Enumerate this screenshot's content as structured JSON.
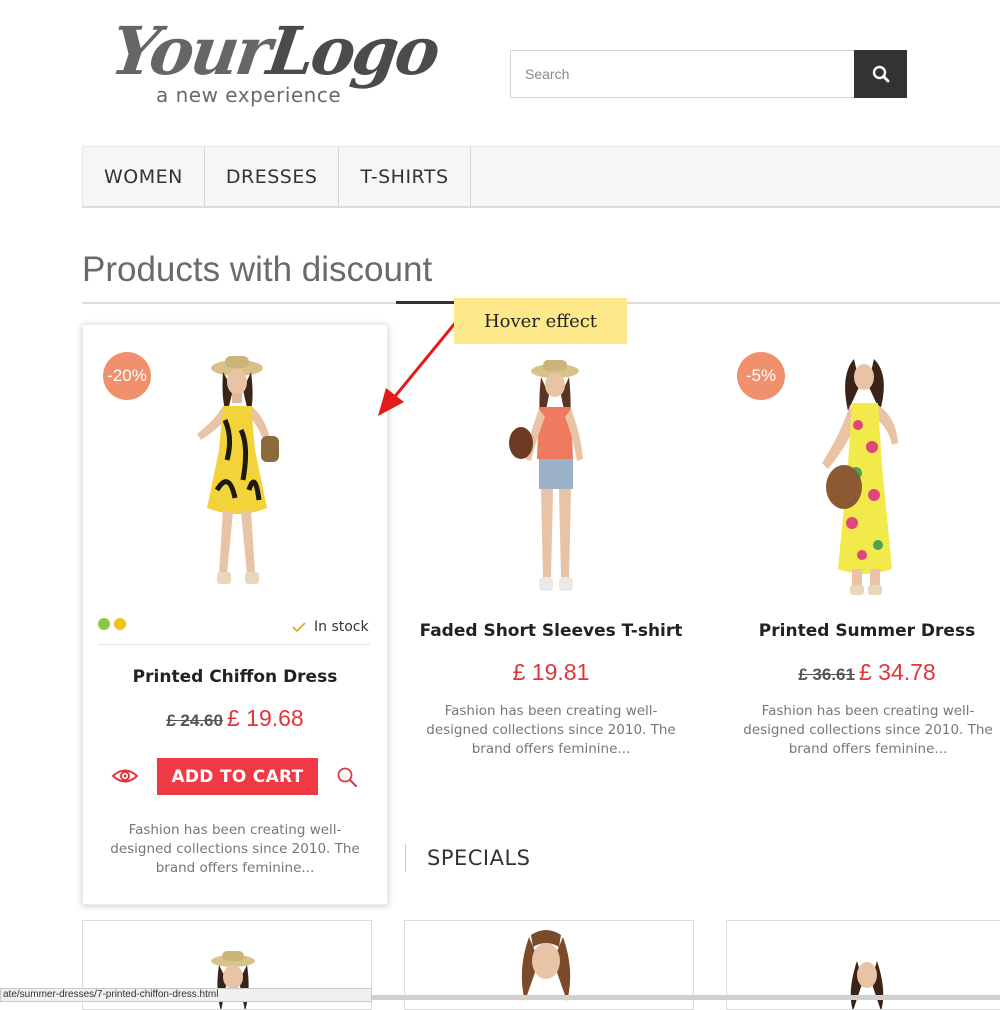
{
  "logo": {
    "text_a": "Your",
    "text_b": "Logo",
    "tagline": "a new experience"
  },
  "search": {
    "placeholder": "Search",
    "value": ""
  },
  "menu": {
    "items": [
      "WOMEN",
      "DRESSES",
      "T-SHIRTS"
    ]
  },
  "section": {
    "title": "Products with discount"
  },
  "annotation": {
    "label": "Hover effect"
  },
  "products": [
    {
      "name": "Printed Chiffon Dress",
      "discount": "-20%",
      "old_price": "£ 24.60",
      "price": "£ 19.68",
      "stock": "In stock",
      "colors": [
        "#8dc63f",
        "#f1c40f"
      ],
      "description": "Fashion has been creating well-designed collections since 2010. The brand offers feminine...",
      "add_to_cart": "ADD TO CART"
    },
    {
      "name": "Faded Short Sleeves T-shirt",
      "discount": "",
      "old_price": "",
      "price": "£ 19.81",
      "description": "Fashion has been creating well-designed collections since 2010. The brand offers feminine..."
    },
    {
      "name": "Printed Summer Dress",
      "discount": "-5%",
      "old_price": "£ 36.61",
      "price": "£ 34.78",
      "description": "Fashion has been creating well-designed collections since 2010. The brand offers feminine..."
    }
  ],
  "specials": {
    "title": "SPECIALS"
  },
  "statusbar": {
    "url": "ate/summer-dresses/7-printed-chiffon-dress.html"
  },
  "colors": {
    "accent": "#ef3a45",
    "price": "#e0353b",
    "badge": "#f0906c",
    "callout": "#fde88a",
    "dark": "#333333"
  },
  "icons": [
    "search-icon",
    "eye-icon",
    "zoom-icon",
    "check-icon",
    "arrow-icon"
  ]
}
